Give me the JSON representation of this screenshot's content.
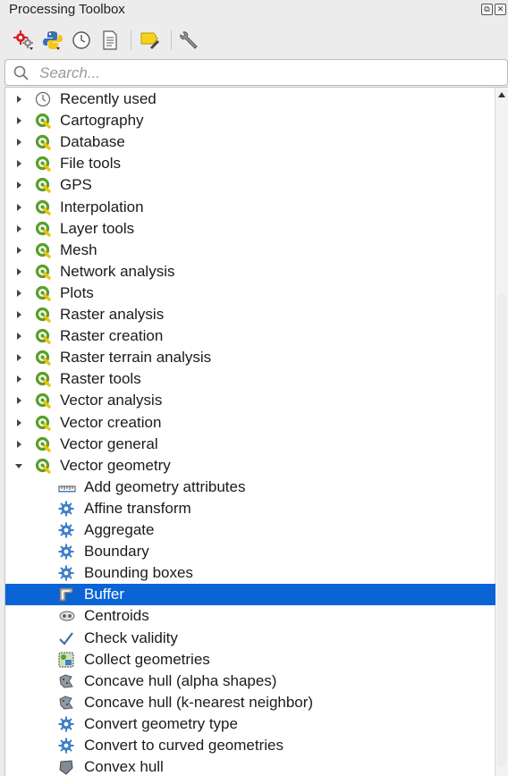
{
  "window": {
    "title": "Processing Toolbox",
    "float_glyph": "⧉",
    "close_glyph": "✕"
  },
  "toolbar": {
    "buttons": [
      {
        "name": "models-icon"
      },
      {
        "name": "python-icon"
      },
      {
        "name": "history-icon"
      },
      {
        "name": "results-viewer-icon"
      },
      {
        "name": "edit-features-in-place-icon"
      },
      {
        "name": "options-icon"
      }
    ]
  },
  "search": {
    "placeholder": "Search...",
    "value": ""
  },
  "tree": {
    "categories": [
      {
        "label": "Recently used",
        "icon": "clock-icon",
        "expanded": false
      },
      {
        "label": "Cartography",
        "icon": "qgis-logo-icon",
        "expanded": false
      },
      {
        "label": "Database",
        "icon": "qgis-logo-icon",
        "expanded": false
      },
      {
        "label": "File tools",
        "icon": "qgis-logo-icon",
        "expanded": false
      },
      {
        "label": "GPS",
        "icon": "qgis-logo-icon",
        "expanded": false
      },
      {
        "label": "Interpolation",
        "icon": "qgis-logo-icon",
        "expanded": false
      },
      {
        "label": "Layer tools",
        "icon": "qgis-logo-icon",
        "expanded": false
      },
      {
        "label": "Mesh",
        "icon": "qgis-logo-icon",
        "expanded": false
      },
      {
        "label": "Network analysis",
        "icon": "qgis-logo-icon",
        "expanded": false
      },
      {
        "label": "Plots",
        "icon": "qgis-logo-icon",
        "expanded": false
      },
      {
        "label": "Raster analysis",
        "icon": "qgis-logo-icon",
        "expanded": false
      },
      {
        "label": "Raster creation",
        "icon": "qgis-logo-icon",
        "expanded": false
      },
      {
        "label": "Raster terrain analysis",
        "icon": "qgis-logo-icon",
        "expanded": false
      },
      {
        "label": "Raster tools",
        "icon": "qgis-logo-icon",
        "expanded": false
      },
      {
        "label": "Vector analysis",
        "icon": "qgis-logo-icon",
        "expanded": false
      },
      {
        "label": "Vector creation",
        "icon": "qgis-logo-icon",
        "expanded": false
      },
      {
        "label": "Vector general",
        "icon": "qgis-logo-icon",
        "expanded": false
      },
      {
        "label": "Vector geometry",
        "icon": "qgis-logo-icon",
        "expanded": true
      }
    ],
    "children": [
      {
        "label": "Add geometry attributes",
        "icon": "ruler-icon"
      },
      {
        "label": "Affine transform",
        "icon": "gear-icon"
      },
      {
        "label": "Aggregate",
        "icon": "gear-icon"
      },
      {
        "label": "Boundary",
        "icon": "gear-icon"
      },
      {
        "label": "Bounding boxes",
        "icon": "gear-icon"
      },
      {
        "label": "Buffer",
        "icon": "buffer-icon",
        "selected": true
      },
      {
        "label": "Centroids",
        "icon": "centroids-icon"
      },
      {
        "label": "Check validity",
        "icon": "checkmark-icon"
      },
      {
        "label": "Collect geometries",
        "icon": "collect-icon"
      },
      {
        "label": "Concave hull (alpha shapes)",
        "icon": "concave-hull-icon"
      },
      {
        "label": "Concave hull (k-nearest neighbor)",
        "icon": "concave-hull-icon"
      },
      {
        "label": "Convert geometry type",
        "icon": "gear-icon"
      },
      {
        "label": "Convert to curved geometries",
        "icon": "gear-icon"
      },
      {
        "label": "Convex hull",
        "icon": "convex-hull-icon"
      }
    ]
  },
  "colors": {
    "selection": "#0a64d6",
    "qgis_green": "#5aa02c",
    "gear_blue": "#3f7fc9"
  }
}
